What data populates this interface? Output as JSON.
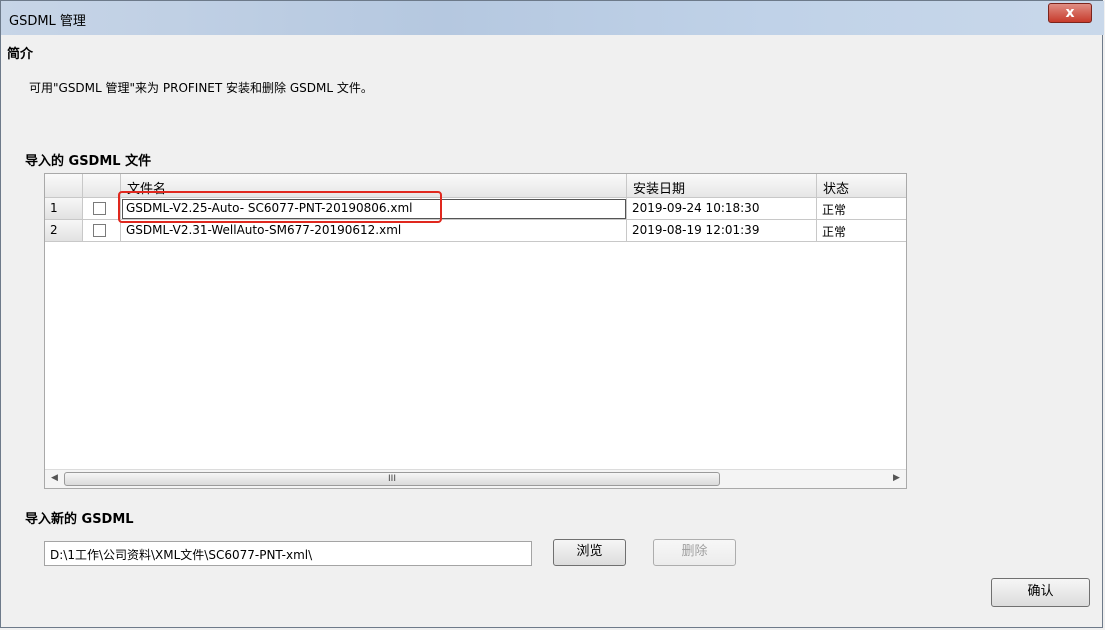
{
  "window": {
    "title": "GSDML 管理",
    "close_glyph": "x"
  },
  "intro": {
    "heading": "简介",
    "text": "可用\"GSDML 管理\"来为 PROFINET 安装和删除 GSDML 文件。"
  },
  "imported": {
    "heading": "导入的 GSDML 文件",
    "columns": {
      "filename": "文件名",
      "date": "安装日期",
      "status": "状态"
    },
    "rows": [
      {
        "index": "1",
        "checked": false,
        "filename": "GSDML-V2.25-Auto- SC6077-PNT-20190806.xml",
        "date": "2019-09-24 10:18:30",
        "status": "正常"
      },
      {
        "index": "2",
        "checked": false,
        "filename": "GSDML-V2.31-WellAuto-SM677-20190612.xml",
        "date": "2019-08-19 12:01:39",
        "status": "正常"
      }
    ],
    "scrollbar": {
      "left_arrow": "◀",
      "right_arrow": "▶",
      "thumb_grip": "III"
    }
  },
  "import_new": {
    "heading": "导入新的 GSDML",
    "path_value": "D:\\1工作\\公司资料\\XML文件\\SC6077-PNT-xml\\",
    "browse_label": "浏览",
    "delete_label": "删除"
  },
  "confirm_label": "确认",
  "colors": {
    "highlight": "#e0281e",
    "titlebar": "#b5c8e0",
    "close": "#c73b2c"
  }
}
